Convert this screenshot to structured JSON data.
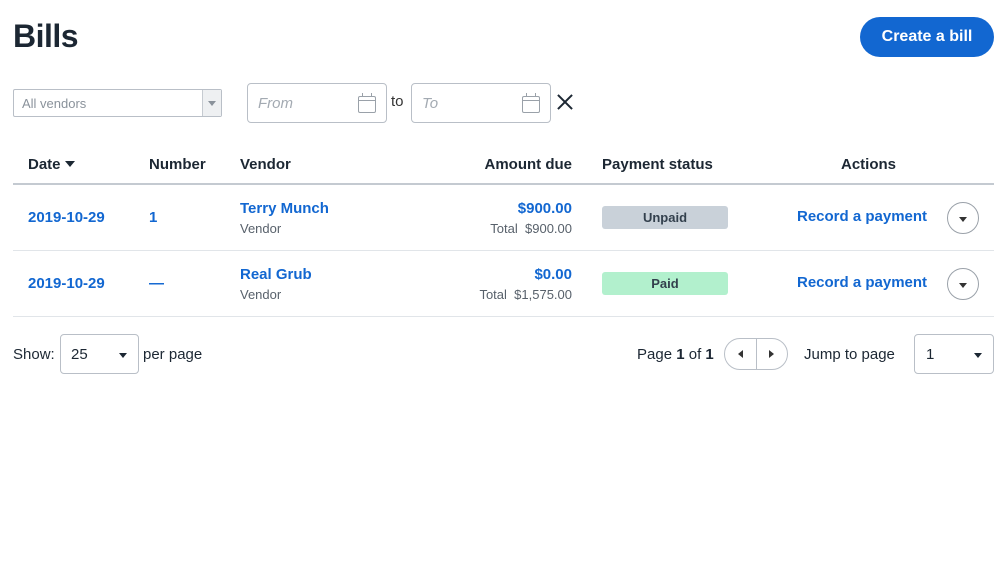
{
  "header": {
    "title": "Bills",
    "create_label": "Create a bill"
  },
  "filters": {
    "vendor_value": "All vendors",
    "from_placeholder": "From",
    "to_label": "to",
    "to_placeholder": "To"
  },
  "table": {
    "columns": {
      "date": "Date",
      "number": "Number",
      "vendor": "Vendor",
      "amount_due": "Amount due",
      "payment_status": "Payment status",
      "actions": "Actions"
    },
    "rows": [
      {
        "date": "2019-10-29",
        "number": "1",
        "vendor_name": "Terry Munch",
        "vendor_sub": "Vendor",
        "amount_due": "$900.00",
        "total_label": "Total",
        "total_value": "$900.00",
        "status": "Unpaid",
        "action": "Record a payment"
      },
      {
        "date": "2019-10-29",
        "number": "—",
        "vendor_name": "Real Grub",
        "vendor_sub": "Vendor",
        "amount_due": "$0.00",
        "total_label": "Total",
        "total_value": "$1,575.00",
        "status": "Paid",
        "action": "Record a payment"
      }
    ]
  },
  "pagination": {
    "show_label": "Show:",
    "per_page_value": "25",
    "per_page_label": "per page",
    "page_word": "Page",
    "current_page": "1",
    "of_word": "of",
    "total_pages": "1",
    "jump_label": "Jump to page",
    "jump_value": "1"
  },
  "icons": {
    "calendar": "calendar-icon",
    "clear": "close-icon",
    "sort": "sort-desc-icon",
    "row_menu": "chevron-down-icon",
    "prev": "chevron-left-icon",
    "next": "chevron-right-icon"
  },
  "colors": {
    "accent": "#1267d1",
    "unpaid_badge": "#c9d1d9",
    "paid_badge": "#b2f0cd"
  }
}
